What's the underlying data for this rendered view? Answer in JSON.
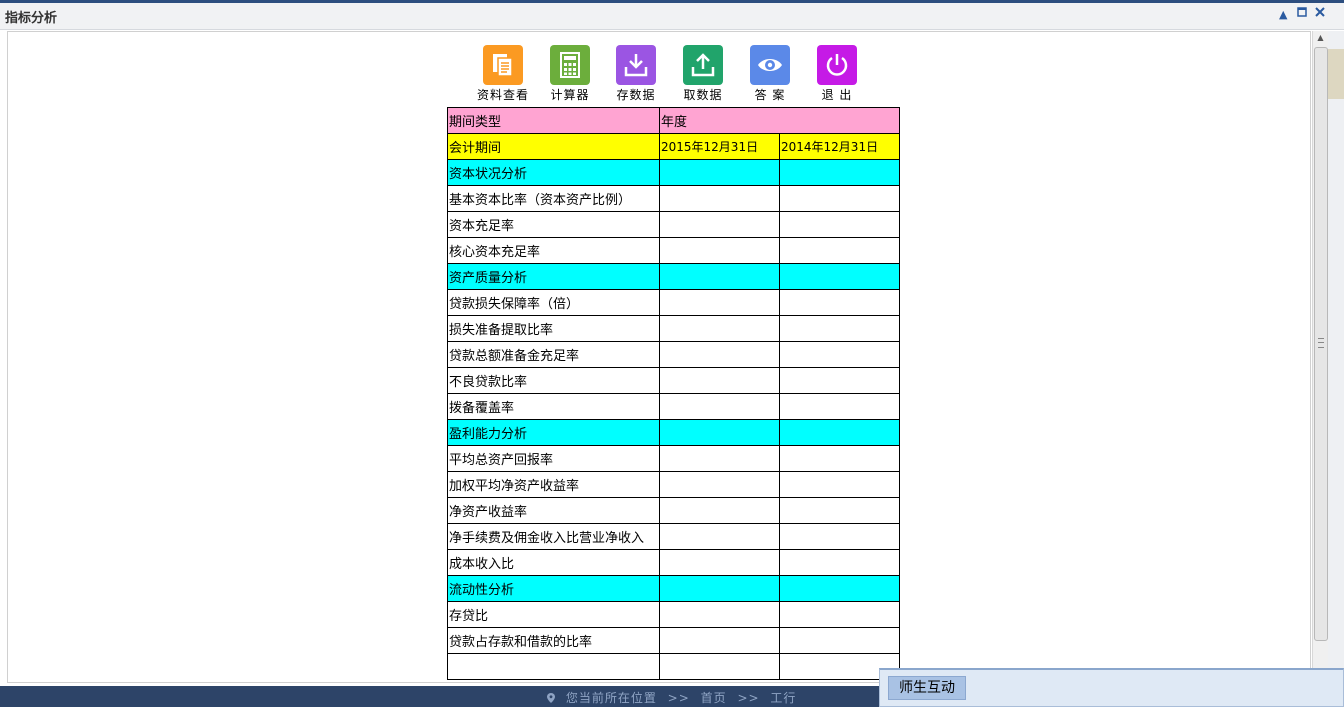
{
  "window": {
    "title": "指标分析"
  },
  "toolbar": [
    {
      "key": "view",
      "label": "资料查看",
      "color": "#fb9a22"
    },
    {
      "key": "calc",
      "label": "计算器",
      "color": "#6cae3c"
    },
    {
      "key": "save",
      "label": "存数据",
      "color": "#9b55e3"
    },
    {
      "key": "load",
      "label": "取数据",
      "color": "#21a46b"
    },
    {
      "key": "answer",
      "label": "答 案",
      "color": "#5b89e8"
    },
    {
      "key": "exit",
      "label": "退 出",
      "color": "#c51ae6"
    }
  ],
  "table": {
    "header": {
      "left": "期间类型",
      "right": "年度"
    },
    "period": {
      "label": "会计期间",
      "col1": "2015年12月31日",
      "col2": "2014年12月31日"
    },
    "rows": [
      {
        "label": "资本状况分析",
        "type": "section"
      },
      {
        "label": "基本资本比率（资本资产比例）",
        "type": "plain"
      },
      {
        "label": "资本充足率",
        "type": "plain"
      },
      {
        "label": "核心资本充足率",
        "type": "plain"
      },
      {
        "label": "资产质量分析",
        "type": "section"
      },
      {
        "label": "贷款损失保障率（倍）",
        "type": "plain"
      },
      {
        "label": "损失准备提取比率",
        "type": "plain"
      },
      {
        "label": "贷款总额准备金充足率",
        "type": "plain"
      },
      {
        "label": "不良贷款比率",
        "type": "plain"
      },
      {
        "label": "拨备覆盖率",
        "type": "plain"
      },
      {
        "label": "盈利能力分析",
        "type": "section"
      },
      {
        "label": "平均总资产回报率",
        "type": "plain"
      },
      {
        "label": "加权平均净资产收益率",
        "type": "plain"
      },
      {
        "label": "净资产收益率",
        "type": "plain"
      },
      {
        "label": "净手续费及佣金收入比营业净收入",
        "type": "plain"
      },
      {
        "label": "成本收入比",
        "type": "plain"
      },
      {
        "label": "流动性分析",
        "type": "section"
      },
      {
        "label": "存贷比",
        "type": "plain"
      },
      {
        "label": "贷款占存款和借款的比率",
        "type": "plain"
      },
      {
        "label": "",
        "type": "plain"
      }
    ]
  },
  "footer": {
    "location_label": "您当前所在位置",
    "sep": ">>",
    "crumb1": "首页",
    "crumb2": "工行"
  },
  "chat": {
    "tab_label": "师生互动"
  },
  "colors": {
    "header_bg": "#ffa4d2",
    "period_bg": "#ffff00",
    "section_bg": "#00ffff",
    "footer_bg": "#2d4468"
  }
}
